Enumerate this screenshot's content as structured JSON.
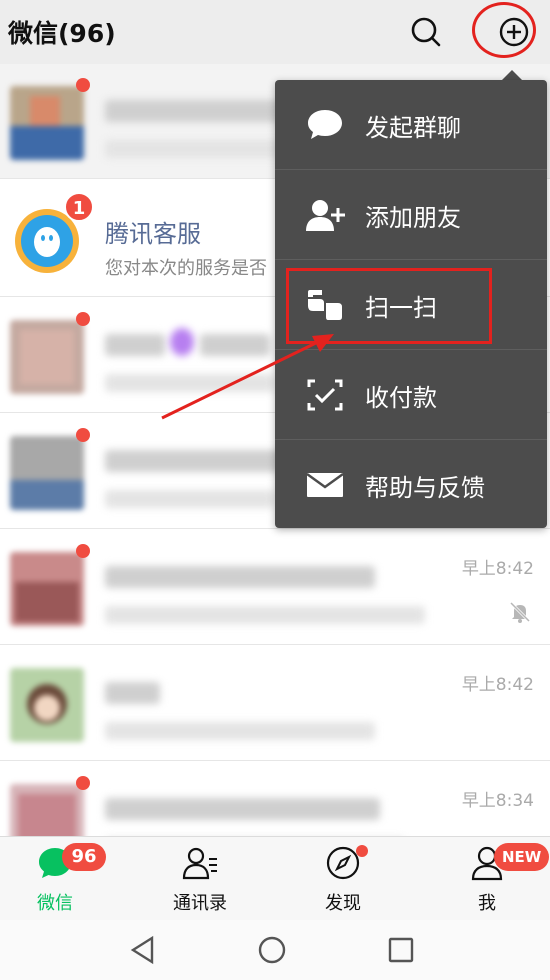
{
  "header": {
    "title": "微信(96)",
    "search_icon": "search-icon",
    "plus_icon": "plus-circle-icon"
  },
  "chats": [
    {
      "name": "",
      "preview": "",
      "time": "",
      "pinned": true,
      "blurred": true,
      "badge": "dot"
    },
    {
      "name": "腾讯客服",
      "preview": "您对本次的服务是否",
      "time": "",
      "pinned": false,
      "blurred": false,
      "badge": "1"
    },
    {
      "name": "",
      "preview": "",
      "time": "",
      "blurred": true,
      "badge": "dot"
    },
    {
      "name": "",
      "preview": "",
      "time": "",
      "blurred": true,
      "badge": "dot"
    },
    {
      "name": "",
      "preview": "",
      "time": "早上8:42",
      "blurred": true,
      "badge": "dot",
      "muted": true
    },
    {
      "name": "",
      "preview": "",
      "time": "早上8:42",
      "blurred": true,
      "badge": ""
    },
    {
      "name": "",
      "preview": "",
      "time": "早上8:34",
      "blurred": true,
      "badge": "dot",
      "muted": true
    }
  ],
  "menu": {
    "items": [
      {
        "label": "发起群聊",
        "icon": "chat-bubble-icon"
      },
      {
        "label": "添加朋友",
        "icon": "add-friend-icon"
      },
      {
        "label": "扫一扫",
        "icon": "scan-icon"
      },
      {
        "label": "收付款",
        "icon": "payment-icon"
      },
      {
        "label": "帮助与反馈",
        "icon": "mail-icon"
      }
    ]
  },
  "tabs": [
    {
      "label": "微信",
      "badge": "96",
      "active": true
    },
    {
      "label": "通讯录"
    },
    {
      "label": "发现",
      "dot": true
    },
    {
      "label": "我",
      "badge": "NEW"
    }
  ],
  "colors": {
    "accent": "#07c160",
    "badge": "#f04c40",
    "highlight": "#e3221e",
    "menu_bg": "#4c4c4c",
    "name_blue": "#576b95"
  }
}
